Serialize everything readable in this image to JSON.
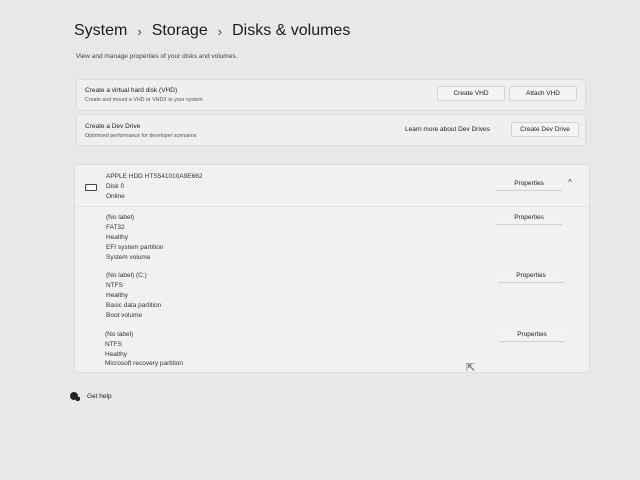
{
  "breadcrumb": {
    "items": [
      "System",
      "Storage",
      "Disks & volumes"
    ],
    "separator": "›"
  },
  "subtitle": "View and manage properties of your disks and volumes.",
  "vhd": {
    "title": "Create a virtual hard disk (VHD)",
    "desc": "Create and mount a VHD or VHDX to your system",
    "create_label": "Create VHD",
    "attach_label": "Attach VHD"
  },
  "devdrive": {
    "title": "Create a Dev Drive",
    "desc": "Optimised performance for developer scenarios",
    "learn_label": "Learn more about Dev Drives",
    "create_label": "Create Dev Drive"
  },
  "disk": {
    "name": "APPLE HDD HTS541010A9E662",
    "number": "Disk 0",
    "status": "Online",
    "properties_label": "Properties",
    "icon": "hdd-icon",
    "collapse_icon": "^"
  },
  "volumes": [
    {
      "lines": [
        "(No label)",
        "FAT32",
        "Healthy",
        "EFI system partition",
        "System volume"
      ],
      "properties_label": "Properties"
    },
    {
      "lines": [
        "(No label) (C:)",
        "NTFS",
        "Healthy",
        "Basic data partition",
        "Boot volume"
      ],
      "properties_label": "Properties"
    },
    {
      "lines": [
        "(No label)",
        "NTFS",
        "Healthy",
        "Microsoft recovery partition"
      ],
      "properties_label": "Properties"
    }
  ],
  "help": {
    "label": "Get help",
    "icon": "help-icon"
  }
}
